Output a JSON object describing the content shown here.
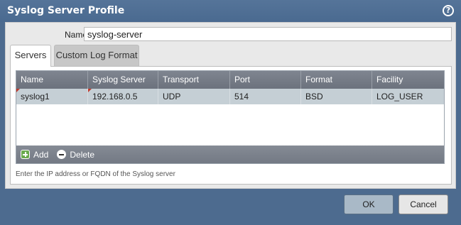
{
  "dialog": {
    "title": "Syslog Server Profile",
    "help_icon": "?"
  },
  "form": {
    "name_label": "Name",
    "name_value": "syslog-server"
  },
  "tabs": [
    {
      "label": "Servers",
      "active": true
    },
    {
      "label": "Custom Log Format",
      "active": false
    }
  ],
  "table": {
    "columns": [
      "Name",
      "Syslog Server",
      "Transport",
      "Port",
      "Format",
      "Facility"
    ],
    "rows": [
      [
        "syslog1",
        "192.168.0.5",
        "UDP",
        "514",
        "BSD",
        "LOG_USER"
      ]
    ]
  },
  "footer": {
    "add_label": "Add",
    "delete_label": "Delete"
  },
  "hint": "Enter the IP address or FQDN of the Syslog server",
  "buttons": {
    "ok": "OK",
    "cancel": "Cancel"
  },
  "colors": {
    "background": "#4d6b8f",
    "header": "#6c727d",
    "selected_row": "#c5cfd5",
    "add_green": "#6aa94e"
  },
  "icons": {
    "help": "help-icon",
    "add": "add-icon",
    "delete": "delete-icon"
  }
}
